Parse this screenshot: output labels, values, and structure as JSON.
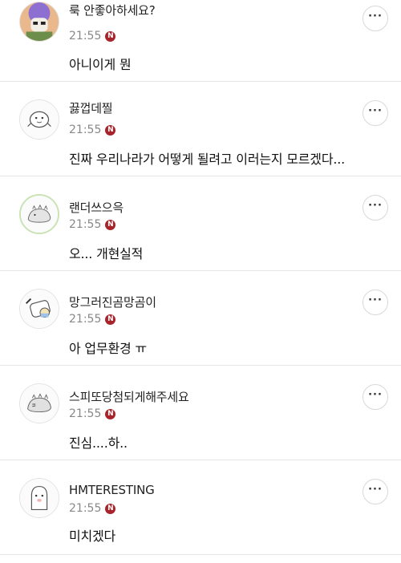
{
  "icons": {
    "more": "more-options-icon",
    "badge": "n-badge-icon"
  },
  "colors": {
    "badge": "#a8232a",
    "divider": "#e6e6e6",
    "time": "#888888"
  },
  "comments": [
    {
      "nickname": "룩 안좋아하세요?",
      "time": "21:55",
      "badge": "N",
      "text": "아니이게 뭔",
      "more_label": "···"
    },
    {
      "nickname": "끓껍데찔",
      "time": "21:55",
      "badge": "N",
      "text": "진짜 우리나라가 어떻게 될려고 이러는지 모르겠다...",
      "more_label": "···"
    },
    {
      "nickname": "랜더쓰으윽",
      "time": "21:55",
      "badge": "N",
      "text": "오... 개현실적",
      "more_label": "···"
    },
    {
      "nickname": "망그러진곰망곰이",
      "time": "21:55",
      "badge": "N",
      "text": "아 업무환경 ㅠ",
      "more_label": "···"
    },
    {
      "nickname": "스피또당첨되게해주세요",
      "time": "21:55",
      "badge": "N",
      "text": "진심....하..",
      "more_label": "···"
    },
    {
      "nickname": "HMTERESTING",
      "time": "21:55",
      "badge": "N",
      "text": "미치겠다",
      "more_label": "···"
    }
  ]
}
